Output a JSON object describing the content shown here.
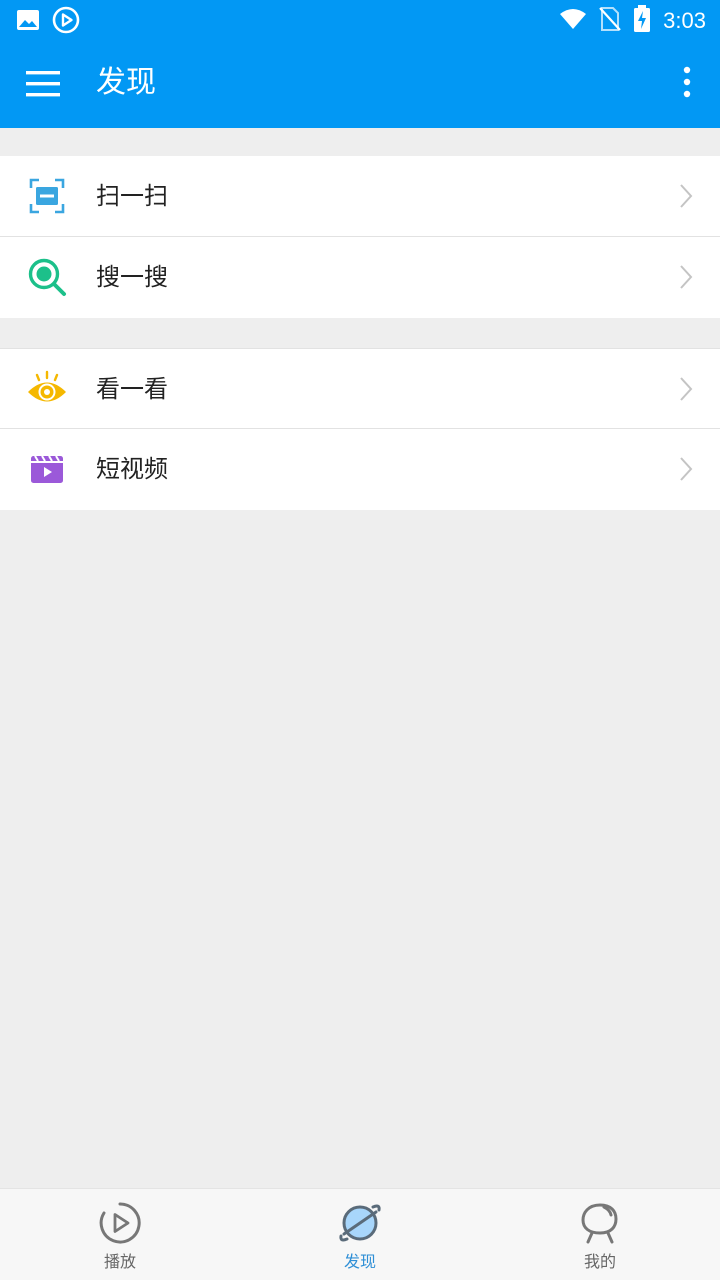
{
  "status_bar": {
    "time": "3:03",
    "left_icons": [
      "image-icon",
      "play-circle-icon"
    ],
    "right_icons": [
      "wifi-icon",
      "no-sim-icon",
      "battery-charging-icon"
    ]
  },
  "app_bar": {
    "title": "发现",
    "left_icon": "menu-icon",
    "right_icon": "more-vert-icon",
    "color": "#0298f4"
  },
  "groups": [
    {
      "items": [
        {
          "label": "扫一扫",
          "icon": "scan-icon",
          "color": "#3aa6e0"
        },
        {
          "label": "搜一搜",
          "icon": "search-icon",
          "color": "#1cc08a"
        }
      ]
    },
    {
      "items": [
        {
          "label": "看一看",
          "icon": "eye-icon",
          "color": "#f5b800"
        },
        {
          "label": "短视频",
          "icon": "video-clapper-icon",
          "color": "#9b59d9"
        }
      ]
    }
  ],
  "bottom_nav": {
    "active_index": 1,
    "active_color": "#2f8fd6",
    "tabs": [
      {
        "label": "播放",
        "icon": "play-circle-icon"
      },
      {
        "label": "发现",
        "icon": "planet-icon"
      },
      {
        "label": "我的",
        "icon": "person-head-icon"
      }
    ]
  }
}
